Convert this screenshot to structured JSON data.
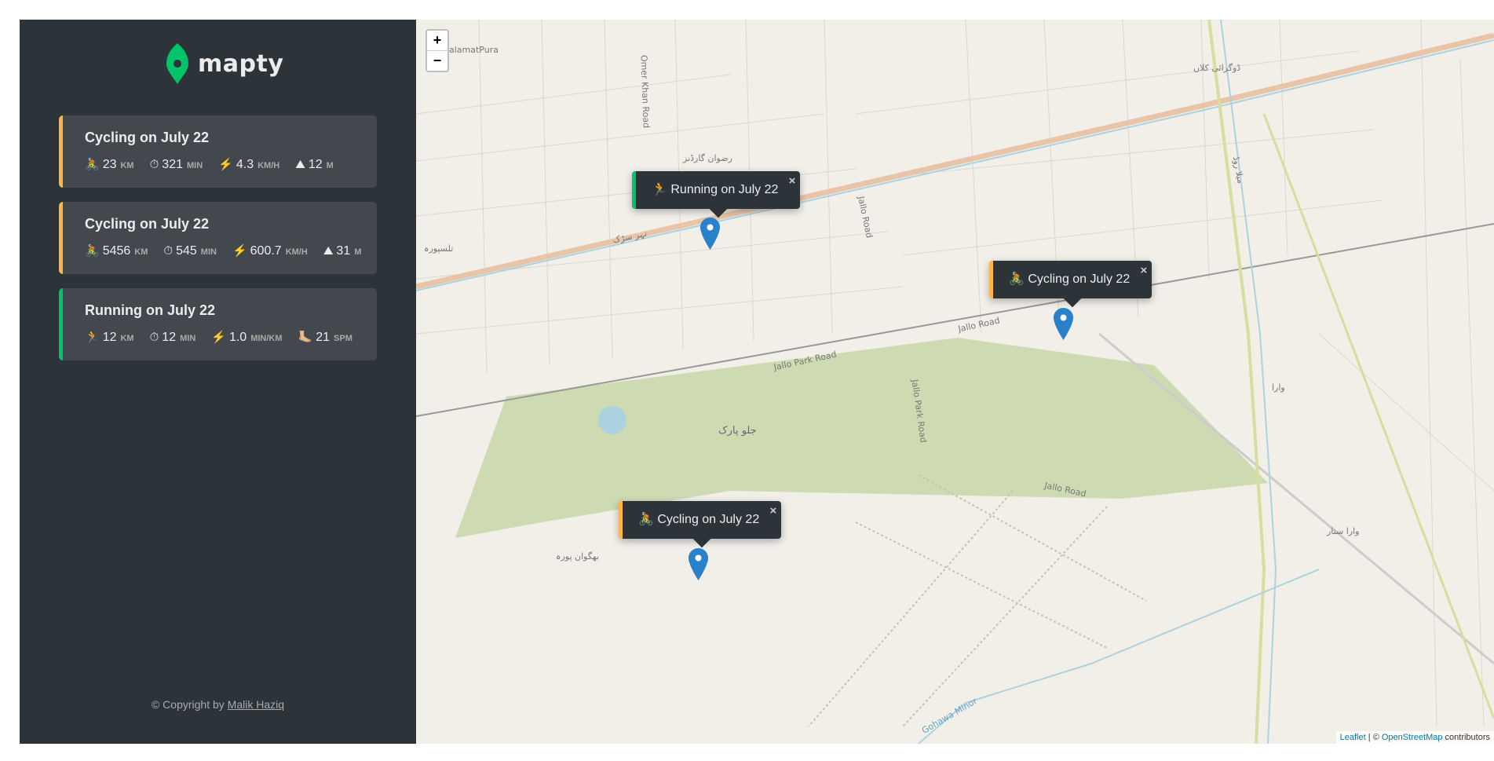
{
  "logo": {
    "text": "mapty",
    "brand_color": "#00c46a"
  },
  "workouts": [
    {
      "type": "cycling",
      "title": "Cycling on July 22",
      "details": [
        {
          "icon": "🚴",
          "value": "23",
          "unit": "km"
        },
        {
          "icon": "⏱",
          "value": "321",
          "unit": "min"
        },
        {
          "icon": "⚡️",
          "value": "4.3",
          "unit": "km/h"
        },
        {
          "icon": "⛰",
          "value": "12",
          "unit": "m"
        }
      ]
    },
    {
      "type": "cycling",
      "title": "Cycling on July 22",
      "details": [
        {
          "icon": "🚴",
          "value": "5456",
          "unit": "km"
        },
        {
          "icon": "⏱",
          "value": "545",
          "unit": "min"
        },
        {
          "icon": "⚡️",
          "value": "600.7",
          "unit": "km/h"
        },
        {
          "icon": "⛰",
          "value": "31",
          "unit": "m"
        }
      ]
    },
    {
      "type": "running",
      "title": "Running on July 22",
      "details": [
        {
          "icon": "🏃",
          "value": "12",
          "unit": "km"
        },
        {
          "icon": "⏱",
          "value": "12",
          "unit": "min"
        },
        {
          "icon": "⚡️",
          "value": "1.0",
          "unit": "min/km"
        },
        {
          "icon": "🦶🏼",
          "value": "21",
          "unit": "spm"
        }
      ]
    }
  ],
  "copyright": {
    "prefix": "© Copyright by",
    "author": "Malik Haziq"
  },
  "map": {
    "zoom_in": "+",
    "zoom_out": "−",
    "popups": [
      {
        "type": "running",
        "icon": "🏃",
        "label": "Running on July 22",
        "close": "×"
      },
      {
        "type": "cycling",
        "icon": "🚴",
        "label": "Cycling on July 22",
        "close": "×"
      },
      {
        "type": "cycling",
        "icon": "🚴",
        "label": "Cycling on July 22",
        "close": "×"
      }
    ],
    "labels": {
      "salamatpura": "SalamatPura",
      "omer_khan": "Omer Khan Road",
      "jallo_park_road": "Jallo Park Road",
      "jallo_road_1": "Jallo Road",
      "jallo_road_2": "Jallo Road",
      "jallo_road_3": "Jallo Road",
      "jallo_park_road_2": "Jallo Park Road",
      "gohawa": "Gohawa Minor",
      "jallo_park_urdu": "جلو پارک",
      "rizwan": "رضوان گارڈنز",
      "nehar": "نہر سڑک",
      "dograi": "ڈوگرائی کلاں",
      "bhagwan": "بھگوان پورہ",
      "wara_sattar": "وارا ستار",
      "wara": "وارا",
      "talsipura": "تلسپورہ",
      "mela_road": "میلا روڈ"
    },
    "attribution": {
      "leaflet": "Leaflet",
      "sep": " | © ",
      "osm": "OpenStreetMap",
      "suffix": " contributors"
    }
  }
}
